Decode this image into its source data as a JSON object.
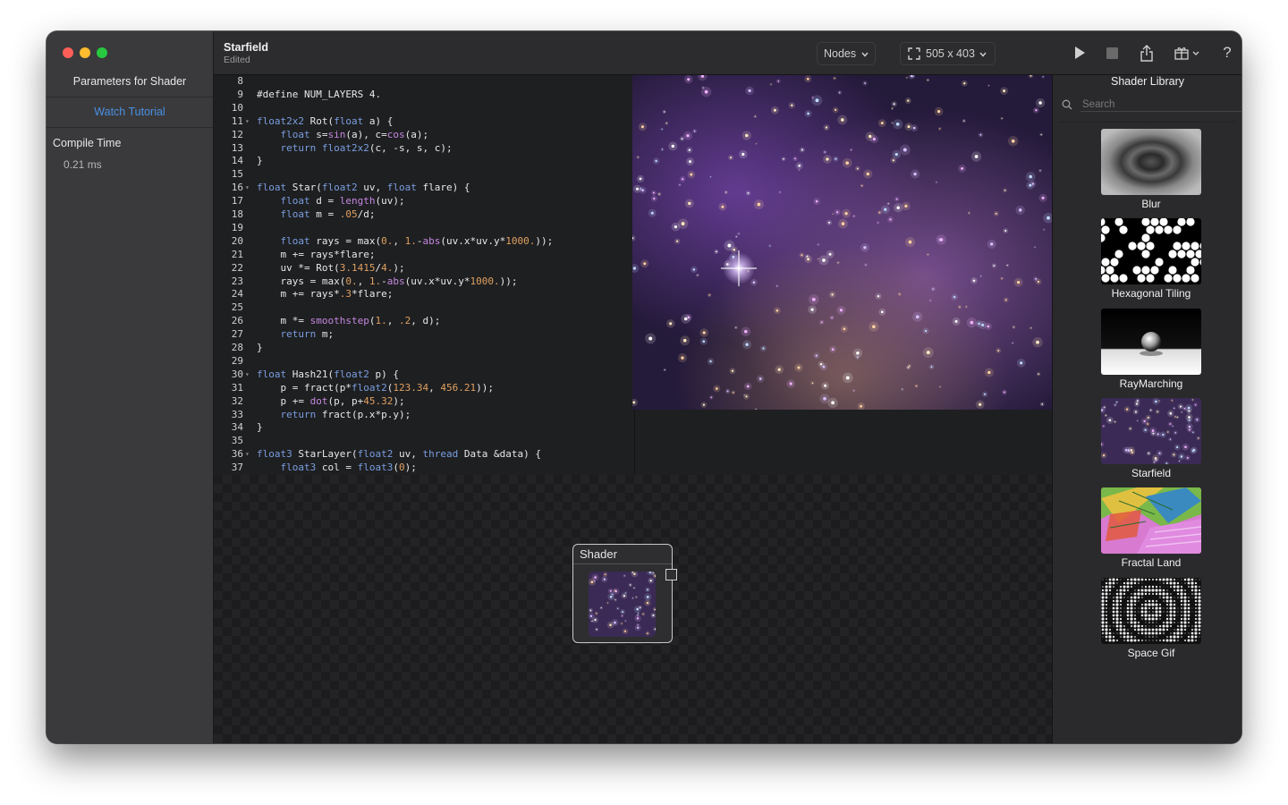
{
  "window": {
    "title": "Starfield",
    "subtitle": "Edited"
  },
  "sidebar": {
    "title": "Parameters for Shader",
    "tutorial_link": "Watch Tutorial",
    "compile_label": "Compile Time",
    "compile_value": "0.21 ms"
  },
  "toolbar": {
    "mode_label": "Nodes",
    "resolution_label": "505 x 403",
    "icons": [
      "play-icon",
      "stop-icon",
      "share-icon",
      "gift-icon",
      "help-icon",
      "sidebar-toggle-icon"
    ]
  },
  "editor": {
    "first_line_number": 8,
    "lines": [
      "",
      "#define NUM_LAYERS 4.",
      "",
      "float2x2 Rot(float a) {",
      "    float s=sin(a), c=cos(a);",
      "    return float2x2(c, -s, s, c);",
      "}",
      "",
      "float Star(float2 uv, float flare) {",
      "    float d = length(uv);",
      "    float m = .05/d;",
      "",
      "    float rays = max(0., 1.-abs(uv.x*uv.y*1000.));",
      "    m += rays*flare;",
      "    uv *= Rot(3.1415/4.);",
      "    rays = max(0., 1.-abs(uv.x*uv.y*1000.));",
      "    m += rays*.3*flare;",
      "",
      "    m *= smoothstep(1., .2, d);",
      "    return m;",
      "}",
      "",
      "float Hash21(float2 p) {",
      "    p = fract(p*float2(123.34, 456.21));",
      "    p += dot(p, p+45.32);",
      "    return fract(p.x*p.y);",
      "}",
      "",
      "float3 StarLayer(float2 uv, thread Data &data) {",
      "    float3 col = float3(0);"
    ],
    "fold_lines": [
      11,
      16,
      30,
      36
    ]
  },
  "node_graph": {
    "node_title": "Shader"
  },
  "library": {
    "title": "Shader Library",
    "search_placeholder": "Search",
    "items": [
      {
        "label": "Blur"
      },
      {
        "label": "Hexagonal Tiling"
      },
      {
        "label": "RayMarching"
      },
      {
        "label": "Starfield"
      },
      {
        "label": "Fractal Land"
      },
      {
        "label": "Space Gif"
      }
    ]
  },
  "colors": {
    "accent_link": "#4a90e2",
    "keyword": "#7a9ee0",
    "function": "#c587e0",
    "number": "#e0a060"
  }
}
